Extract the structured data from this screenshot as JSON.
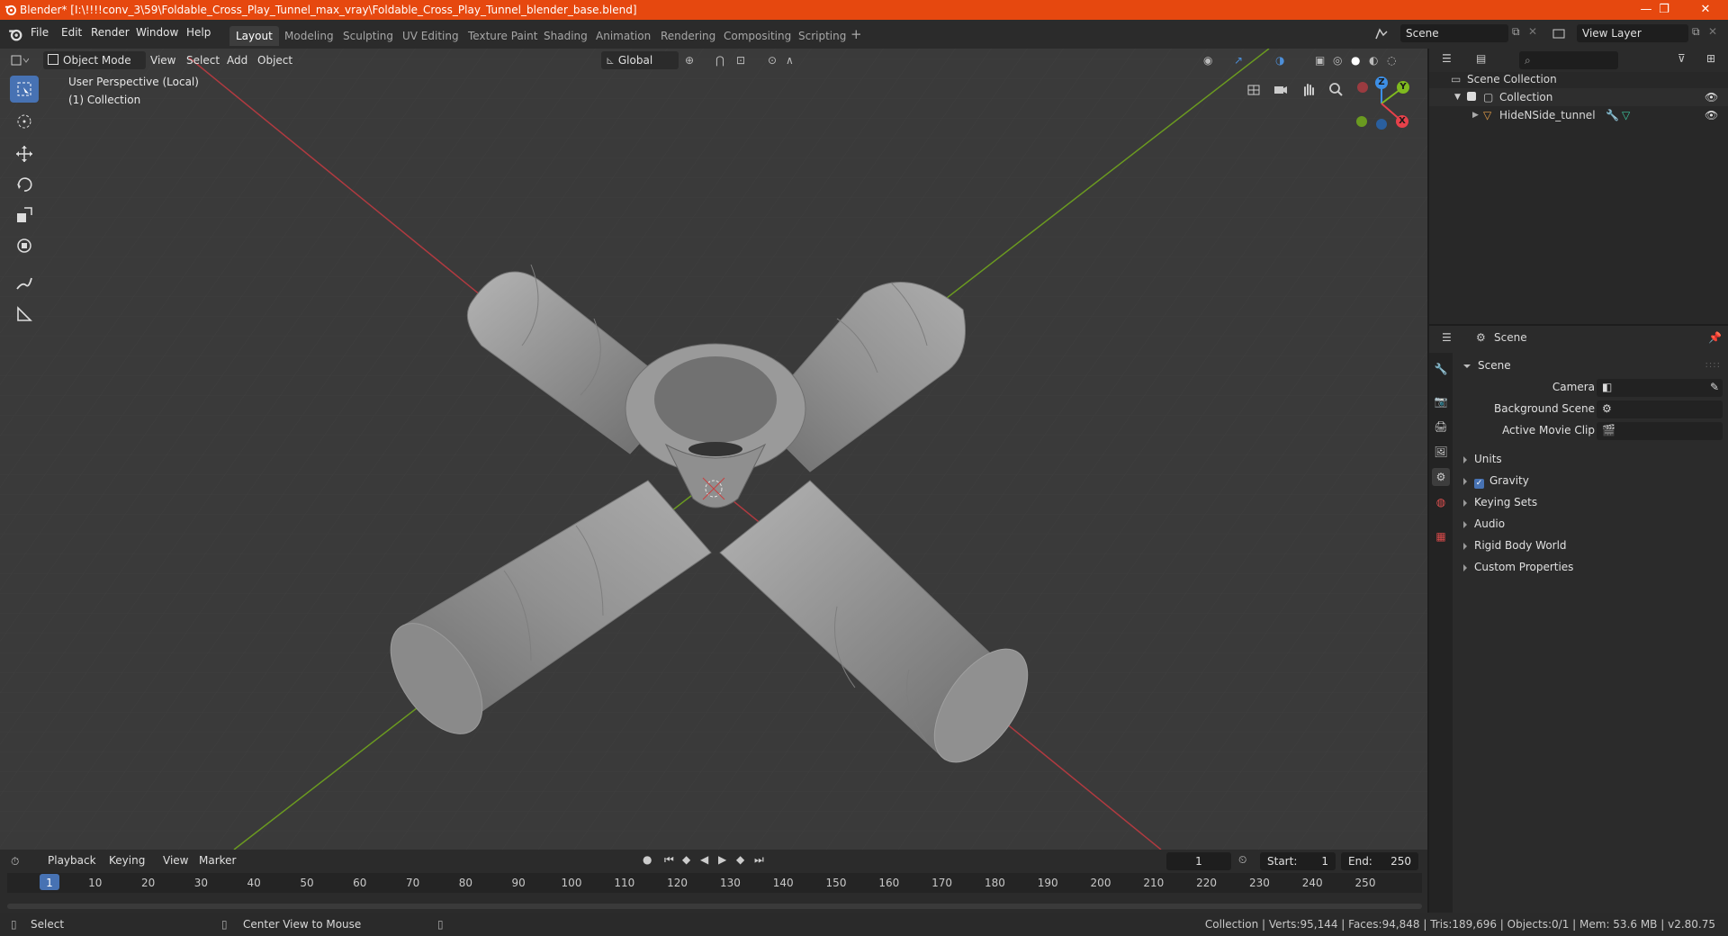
{
  "window": {
    "title": "Blender* [I:\\!!!!conv_3\\59\\Foldable_Cross_Play_Tunnel_max_vray\\Foldable_Cross_Play_Tunnel_blender_base.blend]",
    "minimize": "—",
    "maximize": "❐",
    "close": "✕"
  },
  "menu": {
    "file": "File",
    "edit": "Edit",
    "render": "Render",
    "window": "Window",
    "help": "Help"
  },
  "workspaces": [
    "Layout",
    "Modeling",
    "Sculpting",
    "UV Editing",
    "Texture Paint",
    "Shading",
    "Animation",
    "Rendering",
    "Compositing",
    "Scripting"
  ],
  "workspace_active": "Layout",
  "scene_field": "Scene",
  "view_layer_field": "View Layer",
  "viewport": {
    "mode": "Object Mode",
    "view": "View",
    "select": "Select",
    "add": "Add",
    "object": "Object",
    "orientation": "Global",
    "overlay_line1": "User Perspective (Local)",
    "overlay_line2": "(1) Collection",
    "gizmo": {
      "x": "X",
      "y": "Y",
      "z": "Z"
    }
  },
  "outliner": {
    "scene_collection": "Scene Collection",
    "collection": "Collection",
    "object": "HideNSide_tunnel"
  },
  "properties": {
    "header": "Scene",
    "panel": "Scene",
    "camera_label": "Camera",
    "background_scene_label": "Background Scene",
    "active_movie_clip_label": "Active Movie Clip",
    "sections": [
      "Units",
      "Gravity",
      "Keying Sets",
      "Audio",
      "Rigid Body World",
      "Custom Properties"
    ]
  },
  "timeline": {
    "playback": "Playback",
    "keying": "Keying",
    "view": "View",
    "marker": "Marker",
    "current_frame": "1",
    "start_label": "Start:",
    "start": "1",
    "end_label": "End:",
    "end": "250",
    "ticks": [
      "1",
      "10",
      "20",
      "30",
      "40",
      "50",
      "60",
      "70",
      "80",
      "90",
      "100",
      "110",
      "120",
      "130",
      "140",
      "150",
      "160",
      "170",
      "180",
      "190",
      "200",
      "210",
      "220",
      "230",
      "240",
      "250"
    ]
  },
  "status": {
    "select": "Select",
    "center": "Center View to Mouse",
    "stats": "Collection | Verts:95,144 | Faces:94,848 | Tris:189,696 | Objects:0/1 | Mem: 53.6 MB | v2.80.75"
  },
  "colors": {
    "title_bar": "#e6480f",
    "accent": "#4772b3",
    "axis_x": "#e6414a",
    "axis_y": "#7fba1f",
    "axis_z": "#3d8fe6"
  }
}
